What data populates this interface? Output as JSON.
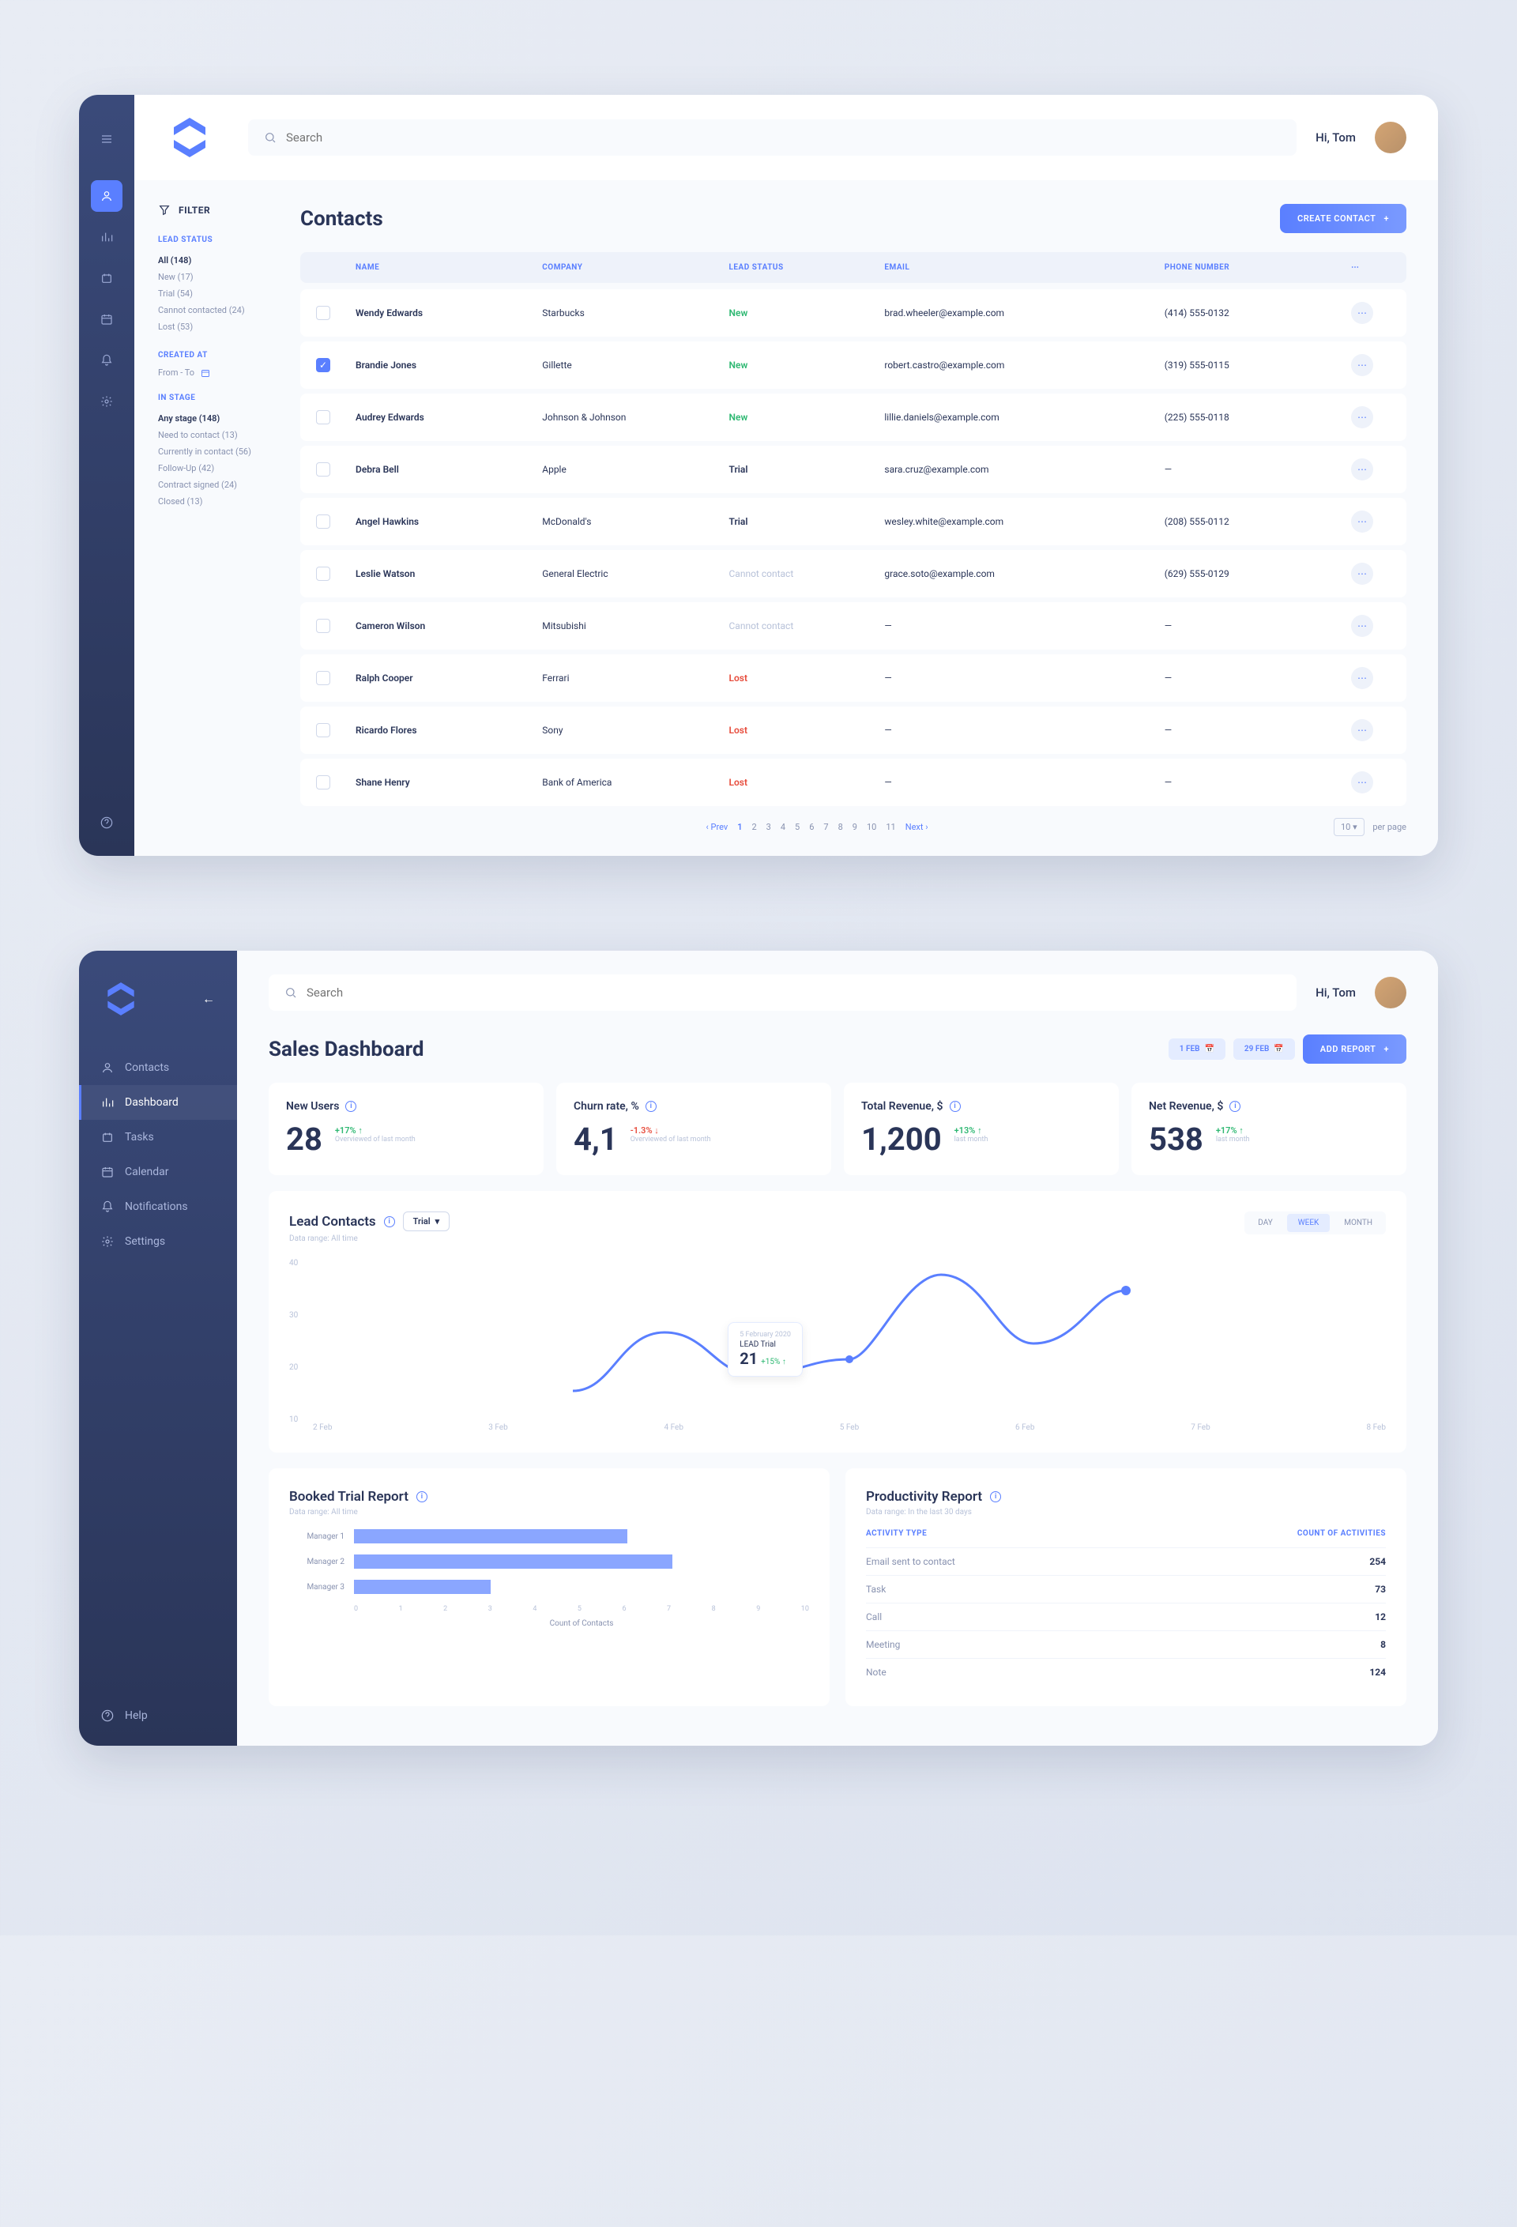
{
  "greeting": "Hi, Tom",
  "search_placeholder": "Search",
  "app1": {
    "title": "Contacts",
    "create_btn": "CREATE CONTACT",
    "filter_label": "FILTER",
    "lead_status_label": "LEAD STATUS",
    "lead_status_items": [
      "All (148)",
      "New (17)",
      "Trial (54)",
      "Cannot contacted (24)",
      "Lost (53)"
    ],
    "created_at_label": "CREATED AT",
    "created_at_value": "From - To",
    "in_stage_label": "IN STAGE",
    "in_stage_items": [
      "Any stage (148)",
      "Need to contact (13)",
      "Currently in contact (56)",
      "Follow-Up (42)",
      "Contract signed (24)",
      "Closed (13)"
    ],
    "cols": {
      "name": "NAME",
      "company": "COMPANY",
      "lead": "LEAD STATUS",
      "email": "EMAIL",
      "phone": "PHONE NUMBER"
    },
    "rows": [
      {
        "chk": false,
        "name": "Wendy Edwards",
        "company": "Starbucks",
        "status": "New",
        "sc": "st-new",
        "email": "brad.wheeler@example.com",
        "phone": "(414) 555-0132"
      },
      {
        "chk": true,
        "name": "Brandie Jones",
        "company": "Gillette",
        "status": "New",
        "sc": "st-new",
        "email": "robert.castro@example.com",
        "phone": "(319) 555-0115"
      },
      {
        "chk": false,
        "name": "Audrey Edwards",
        "company": "Johnson & Johnson",
        "status": "New",
        "sc": "st-new",
        "email": "lillie.daniels@example.com",
        "phone": "(225) 555-0118"
      },
      {
        "chk": false,
        "name": "Debra Bell",
        "company": "Apple",
        "status": "Trial",
        "sc": "st-trial",
        "email": "sara.cruz@example.com",
        "phone": "—"
      },
      {
        "chk": false,
        "name": "Angel Hawkins",
        "company": "McDonald's",
        "status": "Trial",
        "sc": "st-trial",
        "email": "wesley.white@example.com",
        "phone": "(208) 555-0112"
      },
      {
        "chk": false,
        "name": "Leslie Watson",
        "company": "General Electric",
        "status": "Cannot contact",
        "sc": "st-cannot",
        "email": "grace.soto@example.com",
        "phone": "(629) 555-0129"
      },
      {
        "chk": false,
        "name": "Cameron Wilson",
        "company": "Mitsubishi",
        "status": "Cannot contact",
        "sc": "st-cannot",
        "email": "—",
        "phone": "—"
      },
      {
        "chk": false,
        "name": "Ralph Cooper",
        "company": "Ferrari",
        "status": "Lost",
        "sc": "st-lost",
        "email": "—",
        "phone": "—"
      },
      {
        "chk": false,
        "name": "Ricardo Flores",
        "company": "Sony",
        "status": "Lost",
        "sc": "st-lost",
        "email": "—",
        "phone": "—"
      },
      {
        "chk": false,
        "name": "Shane Henry",
        "company": "Bank of America",
        "status": "Lost",
        "sc": "st-lost",
        "email": "—",
        "phone": "—"
      }
    ],
    "pager": {
      "prev": "Prev",
      "next": "Next",
      "pages": [
        "1",
        "2",
        "3",
        "4",
        "5",
        "6",
        "7",
        "8",
        "9",
        "10",
        "11"
      ],
      "per": "10",
      "per_label": "per page"
    }
  },
  "app2": {
    "nav": [
      "Contacts",
      "Dashboard",
      "Tasks",
      "Calendar",
      "Notifications",
      "Settings"
    ],
    "help": "Help",
    "title": "Sales Dashboard",
    "date_from": "1 FEB",
    "date_to": "29 FEB",
    "add_btn": "ADD REPORT",
    "cards": [
      {
        "title": "New Users",
        "val": "28",
        "delta": "+17% ↑",
        "dc": "delta-up",
        "sub": "Overviewed of last month"
      },
      {
        "title": "Churn rate, %",
        "val": "4,1",
        "delta": "-1.3% ↓",
        "dc": "delta-dn",
        "sub": "Overviewed of last month"
      },
      {
        "title": "Total Revenue, $",
        "val": "1,200",
        "delta": "+13% ↑",
        "dc": "delta-up",
        "sub": "last month"
      },
      {
        "title": "Net Revenue, $",
        "val": "538",
        "delta": "+17% ↑",
        "dc": "delta-up",
        "sub": "last month"
      }
    ],
    "lead_chart": {
      "title": "Lead Contacts",
      "range": "Data range: All time",
      "filter": "Trial",
      "seg": [
        "DAY",
        "WEEK",
        "MONTH"
      ],
      "seg_active": 1,
      "tooltip": {
        "date": "5 February 2020",
        "label": "LEAD Trial",
        "val": "21",
        "delta": "+15% ↑"
      }
    },
    "booked": {
      "title": "Booked Trial Report",
      "range": "Data range: All time",
      "xlabel": "Count of Contacts"
    },
    "prod": {
      "title": "Productivity Report",
      "range": "Data range: In the last 30 days",
      "col1": "ACTIVITY TYPE",
      "col2": "COUNT OF ACTIVITIES",
      "rows": [
        {
          "k": "Email sent to contact",
          "v": "254"
        },
        {
          "k": "Task",
          "v": "73"
        },
        {
          "k": "Call",
          "v": "12"
        },
        {
          "k": "Meeting",
          "v": "8"
        },
        {
          "k": "Note",
          "v": "124"
        }
      ]
    }
  },
  "chart_data": [
    {
      "type": "line",
      "title": "Lead Contacts",
      "ylabel": "",
      "xlabel": "",
      "categories": [
        "2 Feb",
        "3 Feb",
        "4 Feb",
        "5 Feb",
        "6 Feb",
        "7 Feb",
        "8 Feb"
      ],
      "values": [
        15,
        26,
        18,
        21,
        37,
        24,
        34
      ],
      "ylim": [
        10,
        40
      ],
      "yticks": [
        10,
        20,
        30,
        40
      ]
    },
    {
      "type": "bar",
      "title": "Booked Trial Report",
      "xlabel": "Count of Contacts",
      "ylabel": "",
      "categories": [
        "Manager 1",
        "Manager 2",
        "Manager 3"
      ],
      "values": [
        6,
        7,
        3
      ],
      "xlim": [
        0,
        10
      ],
      "xticks": [
        0,
        1,
        2,
        3,
        4,
        5,
        6,
        7,
        8,
        9,
        10
      ]
    }
  ]
}
